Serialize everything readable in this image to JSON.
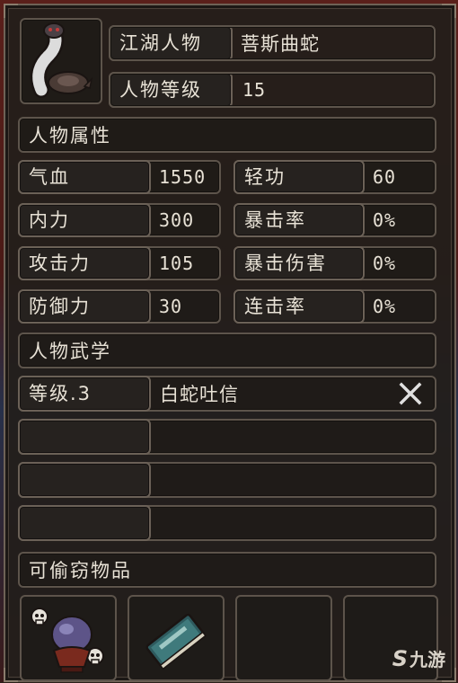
{
  "profile": {
    "name_label": "江湖人物",
    "name_value": "菩斯曲蛇",
    "level_label": "人物等级",
    "level_value": "15"
  },
  "attributes": {
    "section_title": "人物属性",
    "left": [
      {
        "label": "气血",
        "value": "1550"
      },
      {
        "label": "内力",
        "value": "300"
      },
      {
        "label": "攻击力",
        "value": "105"
      },
      {
        "label": "防御力",
        "value": "30"
      }
    ],
    "right": [
      {
        "label": "轻功",
        "value": "60"
      },
      {
        "label": "暴击率",
        "value": "0%"
      },
      {
        "label": "暴击伤害",
        "value": "0%"
      },
      {
        "label": "连击率",
        "value": "0%"
      }
    ]
  },
  "martial": {
    "section_title": "人物武学",
    "skills": [
      {
        "level": "等级.3",
        "name": "白蛇吐信"
      }
    ],
    "remove_icon": "close-icon"
  },
  "stealable": {
    "section_title": "可偷窃物品",
    "items": [
      "potion-item-icon",
      "book-item-icon",
      "",
      ""
    ]
  },
  "watermark": {
    "symbol": "S",
    "text": "九游"
  },
  "colors": {
    "panel_bg": "#221e1b",
    "border": "#5d544b",
    "text": "#e8e2d6",
    "close": "#e0e0e0"
  }
}
